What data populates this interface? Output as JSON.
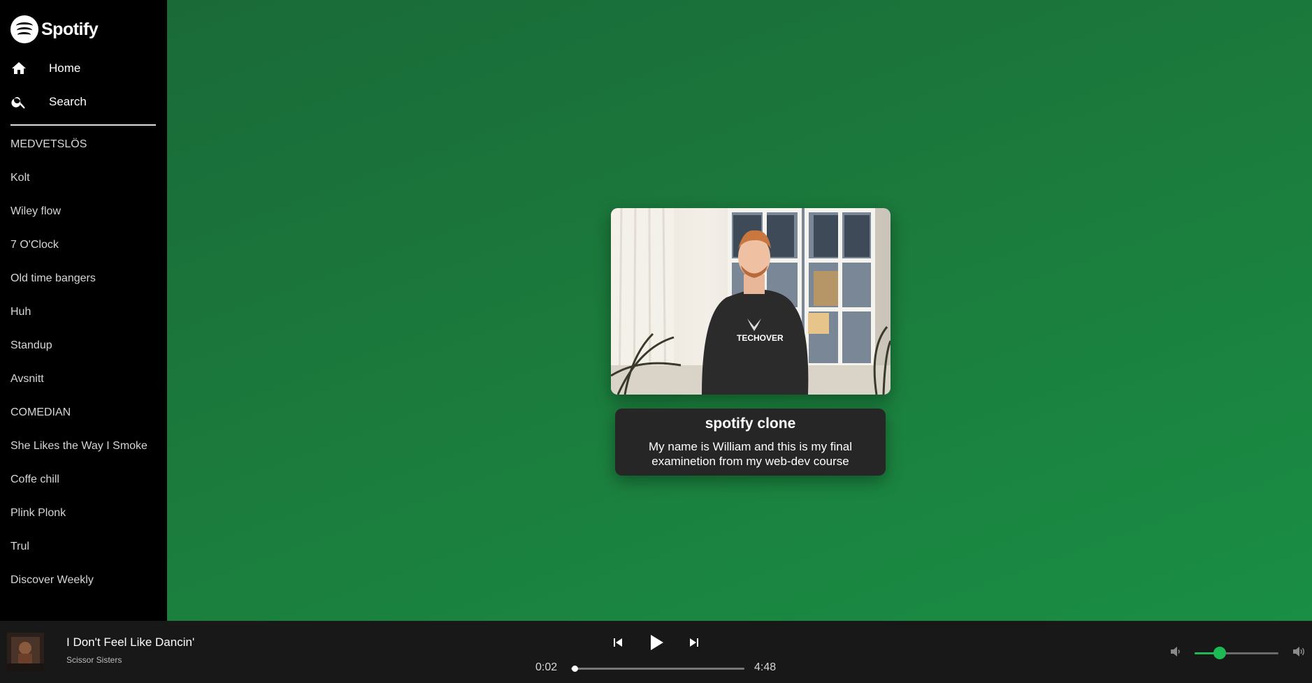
{
  "brand": {
    "name": "Spotify",
    "accent_color": "#1db954"
  },
  "nav": [
    {
      "label": "Home",
      "icon": "home-icon"
    },
    {
      "label": "Search",
      "icon": "search-icon"
    }
  ],
  "playlists": [
    "MEDVETSLÖS",
    "Kolt",
    "Wiley flow",
    "7 O'Clock",
    "Old time bangers",
    "Huh",
    "Standup",
    "Avsnitt",
    "COMEDIAN",
    "She Likes the Way I Smoke",
    "Coffe chill",
    "Plink Plonk",
    "Trul",
    "Discover Weekly"
  ],
  "hero": {
    "image": "portrait-photo",
    "sweatshirt_text": "TECHOVER",
    "title": "spotify clone",
    "description": "My name is William and this is my final examinetion from my web-dev course"
  },
  "player": {
    "track_title": "I Don't Feel Like Dancin'",
    "artist": "Scissor Sisters",
    "current_time": "0:02",
    "duration": "4:48",
    "progress_fraction": 0.007,
    "volume_fraction": 0.3,
    "controls": [
      "skip-previous-icon",
      "play-icon",
      "skip-next-icon"
    ]
  }
}
